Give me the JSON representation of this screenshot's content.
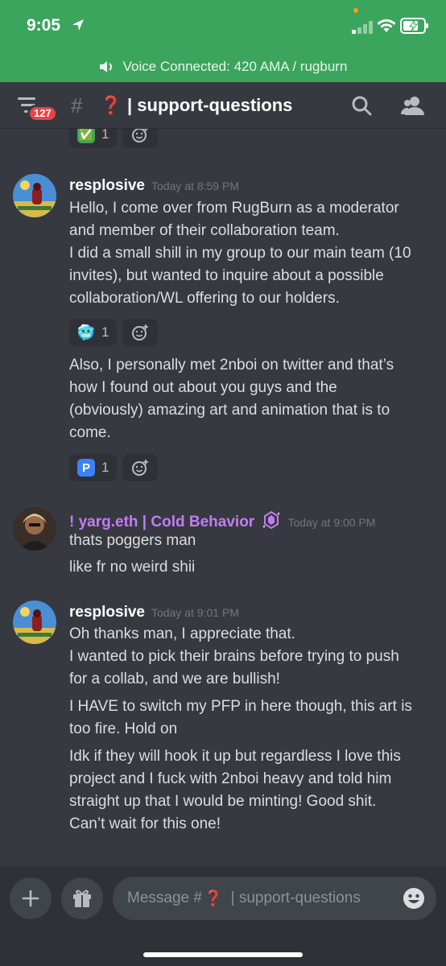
{
  "status_bar": {
    "time": "9:05"
  },
  "voice_banner": {
    "text": "Voice Connected: 420 AMA / rugburn"
  },
  "header": {
    "unread_count": "127",
    "hash": "#",
    "channel_emoji": "❓",
    "channel_name": "| support-questions"
  },
  "messages": [
    {
      "reaction": {
        "emoji": "✅",
        "count": "1"
      }
    },
    {
      "author": "resplosive",
      "timestamp": "Today at 8:59 PM",
      "lines": [
        "Hello, I come over from RugBurn as a moderator",
        "and member of their collaboration team.",
        "I did a small shill in my group to our main team (10",
        "invites), but wanted to inquire about a possible",
        "collaboration/WL offering to our holders."
      ],
      "reaction1": {
        "emoji": "🥶",
        "count": "1"
      },
      "lines2": [
        "Also, I personally met 2nboi on twitter and that’s",
        "how I found out about you guys and the",
        "(obviously) amazing art and animation that is to",
        "come."
      ],
      "reaction2": {
        "emoji": "P",
        "count": "1"
      }
    },
    {
      "author": "! yarg.eth | Cold Behavior",
      "timestamp": "Today at 9:00 PM",
      "lines": [
        "thats poggers man",
        "like fr no weird shii"
      ]
    },
    {
      "author": "resplosive",
      "timestamp": "Today at 9:01 PM",
      "lines": [
        "Oh thanks man, I appreciate that.",
        "I wanted to pick their brains before trying to push",
        "for a collab, and we are bullish!",
        "I HAVE to switch my PFP in here though, this art is",
        "too fire. Hold on",
        "Idk if they will hook it up but regardless I love this",
        "project and I fuck with 2nboi heavy and told him",
        "straight up that I would be minting! Good shit.",
        "Can’t wait for this one!"
      ]
    }
  ],
  "composer": {
    "placeholder_prefix": "Message #",
    "placeholder_emoji": "❓",
    "placeholder_channel": "| support-questions"
  },
  "colors": {
    "voice_green": "#3ba55d",
    "bg": "#36393f",
    "badge_red": "#ed4245",
    "username_purple": "#c27cf3"
  }
}
